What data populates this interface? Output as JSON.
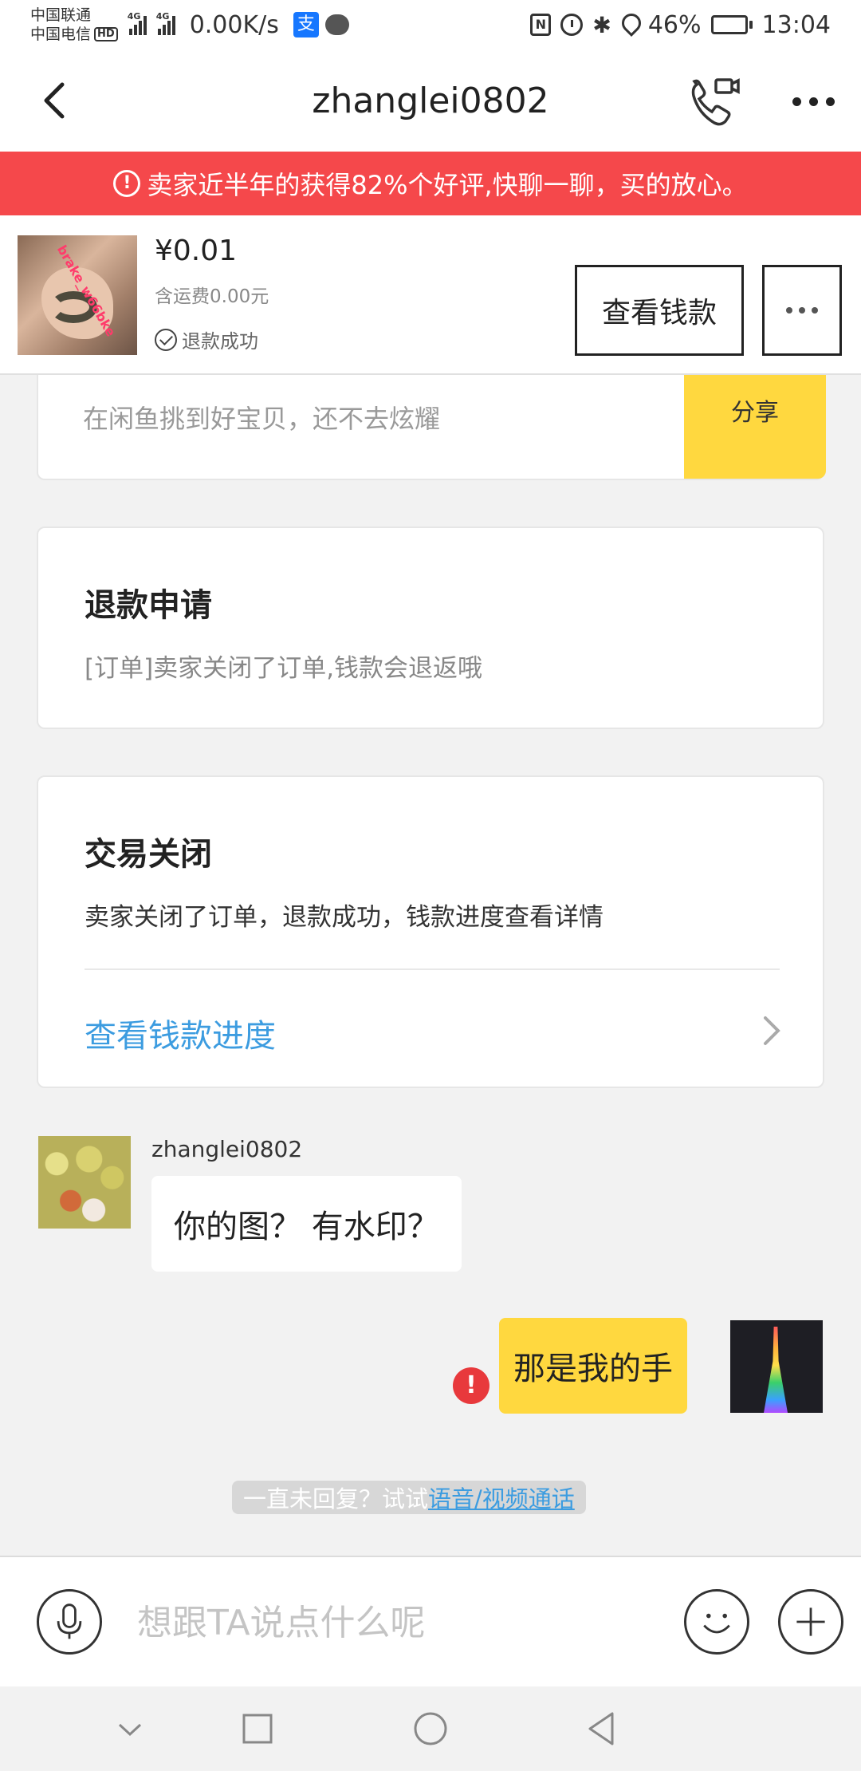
{
  "status_bar": {
    "carrier_1": "中国联通",
    "carrier_2": "中国电信",
    "hd": "HD",
    "net_type_1": "4G",
    "net_type_2": "4G",
    "net_speed": "0.00K/s",
    "alipay_glyph": "支",
    "battery_percent": "46%",
    "battery_level": 0.46,
    "nfc_glyph": "N",
    "bt_glyph": "✱",
    "time": "13:04"
  },
  "header": {
    "title": "zhanglei0802"
  },
  "banner": {
    "icon": "!",
    "text": "卖家近半年的获得82%个好评,快聊一聊，买的放心。"
  },
  "order": {
    "image_text": "brake_w66bke",
    "price": "¥0.01",
    "shipping": "含运费0.00元",
    "status": "退款成功",
    "view_money_label": "查看钱款"
  },
  "share_card": {
    "text": "在闲鱼挑到好宝贝，还不去炫耀",
    "button": "分享"
  },
  "refund_card": {
    "title": "退款申请",
    "body": "[订单]卖家关闭了订单,钱款会退返哦"
  },
  "closed_card": {
    "title": "交易关闭",
    "body": "卖家关闭了订单，退款成功，钱款进度查看详情",
    "link": "查看钱款进度"
  },
  "messages": [
    {
      "sender": "zhanglei0802",
      "text": "你的图？ 有水印？",
      "from_self": false
    },
    {
      "sender": "",
      "text": "那是我的手",
      "from_self": true,
      "failed": true,
      "failed_glyph": "!"
    }
  ],
  "hint": {
    "prefix": "一直未回复？试试 ",
    "link": "语音/视频通话"
  },
  "input": {
    "placeholder": "想跟TA说点什么呢",
    "value": ""
  },
  "colors": {
    "banner_red": "#f5484b",
    "accent_yellow": "#ffd83f",
    "link_blue": "#3c9ce0",
    "error_red": "#e8393c"
  },
  "icons": [
    "back-icon",
    "video-call-icon",
    "more-icon",
    "warning-icon",
    "check-icon",
    "chevron-right-icon",
    "error-icon",
    "mic-icon",
    "emoji-icon",
    "plus-icon",
    "nav-down-icon",
    "nav-recent-icon",
    "nav-home-icon",
    "nav-back-icon"
  ]
}
